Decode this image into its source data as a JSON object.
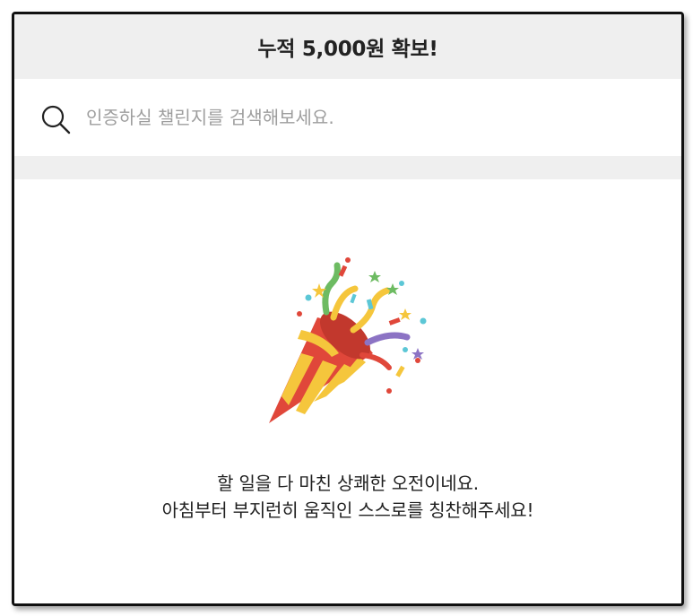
{
  "header": {
    "title": "누적 5,000원 확보!"
  },
  "search": {
    "placeholder": "인증하실 챌린지를 검색해보세요.",
    "value": "",
    "icon": "search-icon"
  },
  "empty_state": {
    "icon": "party-popper-icon",
    "line1": "할 일을 다 마친 상쾌한 오전이네요.",
    "line2": "아침부터 부지런히 움직인 스스로를 칭찬해주세요!"
  },
  "colors": {
    "header_bg": "#efefef",
    "band_bg": "#efefef",
    "popper_red": "#e0473a",
    "popper_yellow": "#f5c63c"
  }
}
